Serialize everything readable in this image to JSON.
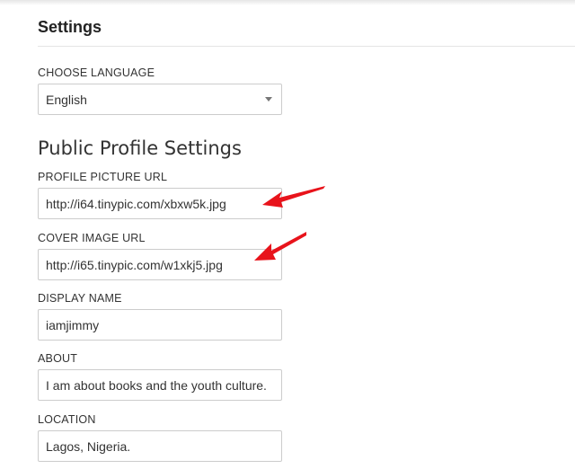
{
  "header": {
    "title": "Settings"
  },
  "language": {
    "label": "CHOOSE LANGUAGE",
    "selected": "English"
  },
  "public_profile": {
    "heading": "Public Profile Settings",
    "fields": [
      {
        "label": "PROFILE PICTURE URL",
        "value": "http://i64.tinypic.com/xbxw5k.jpg"
      },
      {
        "label": "COVER IMAGE URL",
        "value": "http://i65.tinypic.com/w1xkj5.jpg"
      },
      {
        "label": "DISPLAY NAME",
        "value": "iamjimmy"
      },
      {
        "label": "ABOUT",
        "value": "I am about books and the youth culture."
      },
      {
        "label": "LOCATION",
        "value": "Lagos, Nigeria."
      }
    ]
  },
  "annotation_color": "#e8131b"
}
